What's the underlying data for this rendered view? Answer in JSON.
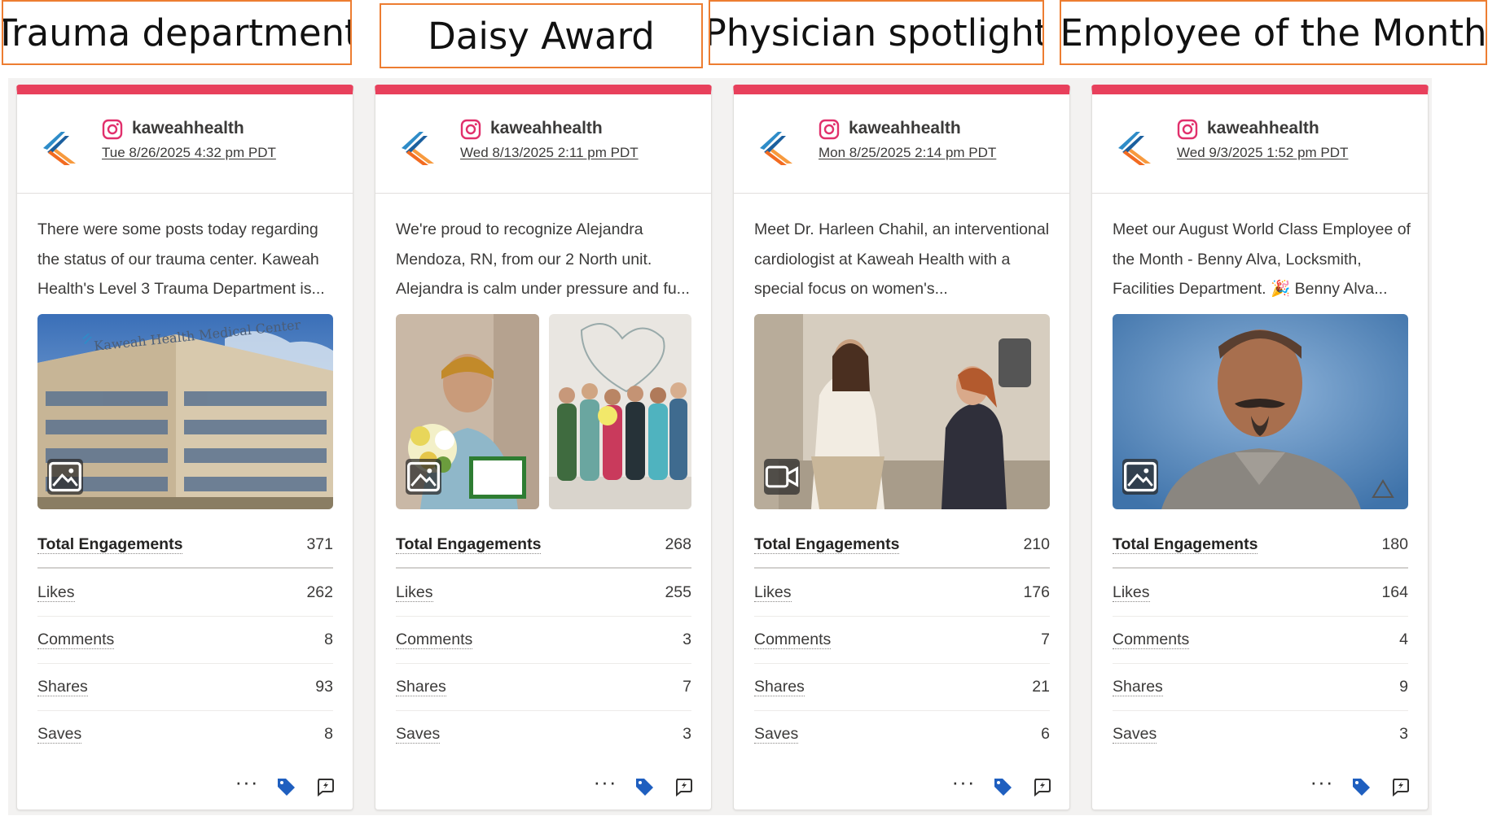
{
  "headers": [
    "Trauma department",
    "Daisy Award",
    "Physician spotlight",
    "Employee of the Month"
  ],
  "colors": {
    "card_accent": "#e8405c",
    "tag_icon": "#1f5fbf",
    "header_border": "#ed7d31"
  },
  "cards": [
    {
      "account": "kaweahhealth",
      "date": "Tue 8/26/2025 4:32 pm PDT",
      "caption": "There were some posts today regarding the status of our trauma center. Kaweah Health's Level 3 Trauma Department is...",
      "media_type": "image-icon",
      "media_text": "Kaweah Health Medical Center",
      "stats": [
        {
          "label": "Total Engagements",
          "value": "371"
        },
        {
          "label": "Likes",
          "value": "262"
        },
        {
          "label": "Comments",
          "value": "8"
        },
        {
          "label": "Shares",
          "value": "93"
        },
        {
          "label": "Saves",
          "value": "8"
        }
      ]
    },
    {
      "account": "kaweahhealth",
      "date": "Wed 8/13/2025 2:11 pm PDT",
      "caption": "We're proud to recognize Alejandra Mendoza, RN, from our 2 North unit. Alejandra is calm under pressure and fu...",
      "media_type": "image-icon",
      "stats": [
        {
          "label": "Total Engagements",
          "value": "268"
        },
        {
          "label": "Likes",
          "value": "255"
        },
        {
          "label": "Comments",
          "value": "3"
        },
        {
          "label": "Shares",
          "value": "7"
        },
        {
          "label": "Saves",
          "value": "3"
        }
      ]
    },
    {
      "account": "kaweahhealth",
      "date": "Mon 8/25/2025 2:14 pm PDT",
      "caption": "Meet Dr. Harleen Chahil, an interventional cardiologist at Kaweah Health with a special focus on women's...",
      "media_type": "video-icon",
      "stats": [
        {
          "label": "Total Engagements",
          "value": "210"
        },
        {
          "label": "Likes",
          "value": "176"
        },
        {
          "label": "Comments",
          "value": "7"
        },
        {
          "label": "Shares",
          "value": "21"
        },
        {
          "label": "Saves",
          "value": "6"
        }
      ]
    },
    {
      "account": "kaweahhealth",
      "date": "Wed 9/3/2025 1:52 pm PDT",
      "caption": "Meet our August World Class Employee of the Month - Benny Alva, Locksmith, Facilities Department. 🎉 Benny Alva...",
      "media_type": "image-icon",
      "stats": [
        {
          "label": "Total Engagements",
          "value": "180"
        },
        {
          "label": "Likes",
          "value": "164"
        },
        {
          "label": "Comments",
          "value": "4"
        },
        {
          "label": "Shares",
          "value": "9"
        },
        {
          "label": "Saves",
          "value": "3"
        }
      ]
    }
  ]
}
